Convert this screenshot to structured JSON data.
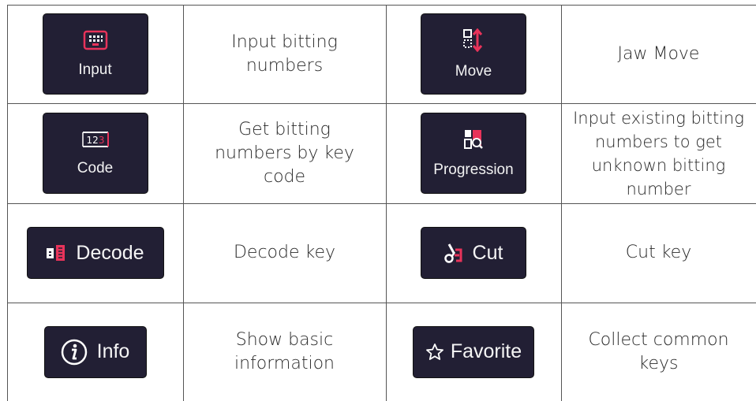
{
  "rows": [
    {
      "left_button": {
        "label": "Input",
        "icon": "keypad-icon"
      },
      "left_desc": [
        "Input bitting",
        "numbers"
      ],
      "right_button": {
        "label": "Move",
        "icon": "jaw-move-icon"
      },
      "right_desc": [
        "Jaw Move"
      ]
    },
    {
      "left_button": {
        "label": "Code",
        "icon": "code-123-icon"
      },
      "left_desc": [
        "Get bitting",
        "numbers by key",
        "code"
      ],
      "right_button": {
        "label": "Progression",
        "icon": "progression-icon"
      },
      "right_desc": [
        "Input existing bitting",
        "numbers to get",
        "unknown bitting",
        "number"
      ]
    },
    {
      "left_button": {
        "label": "Decode",
        "icon": "decode-icon"
      },
      "left_desc": [
        "Decode key"
      ],
      "right_button": {
        "label": "Cut",
        "icon": "cut-icon"
      },
      "right_desc": [
        "Cut key"
      ]
    },
    {
      "left_button": {
        "label": "Info",
        "icon": "info-icon"
      },
      "left_desc": [
        "Show basic",
        "information"
      ],
      "right_button": {
        "label": "Favorite",
        "icon": "star-icon"
      },
      "right_desc": [
        "Collect common",
        "keys"
      ]
    }
  ],
  "colors": {
    "tile_bg": "#221f34",
    "accent": "#e8335a",
    "border": "#555555"
  }
}
